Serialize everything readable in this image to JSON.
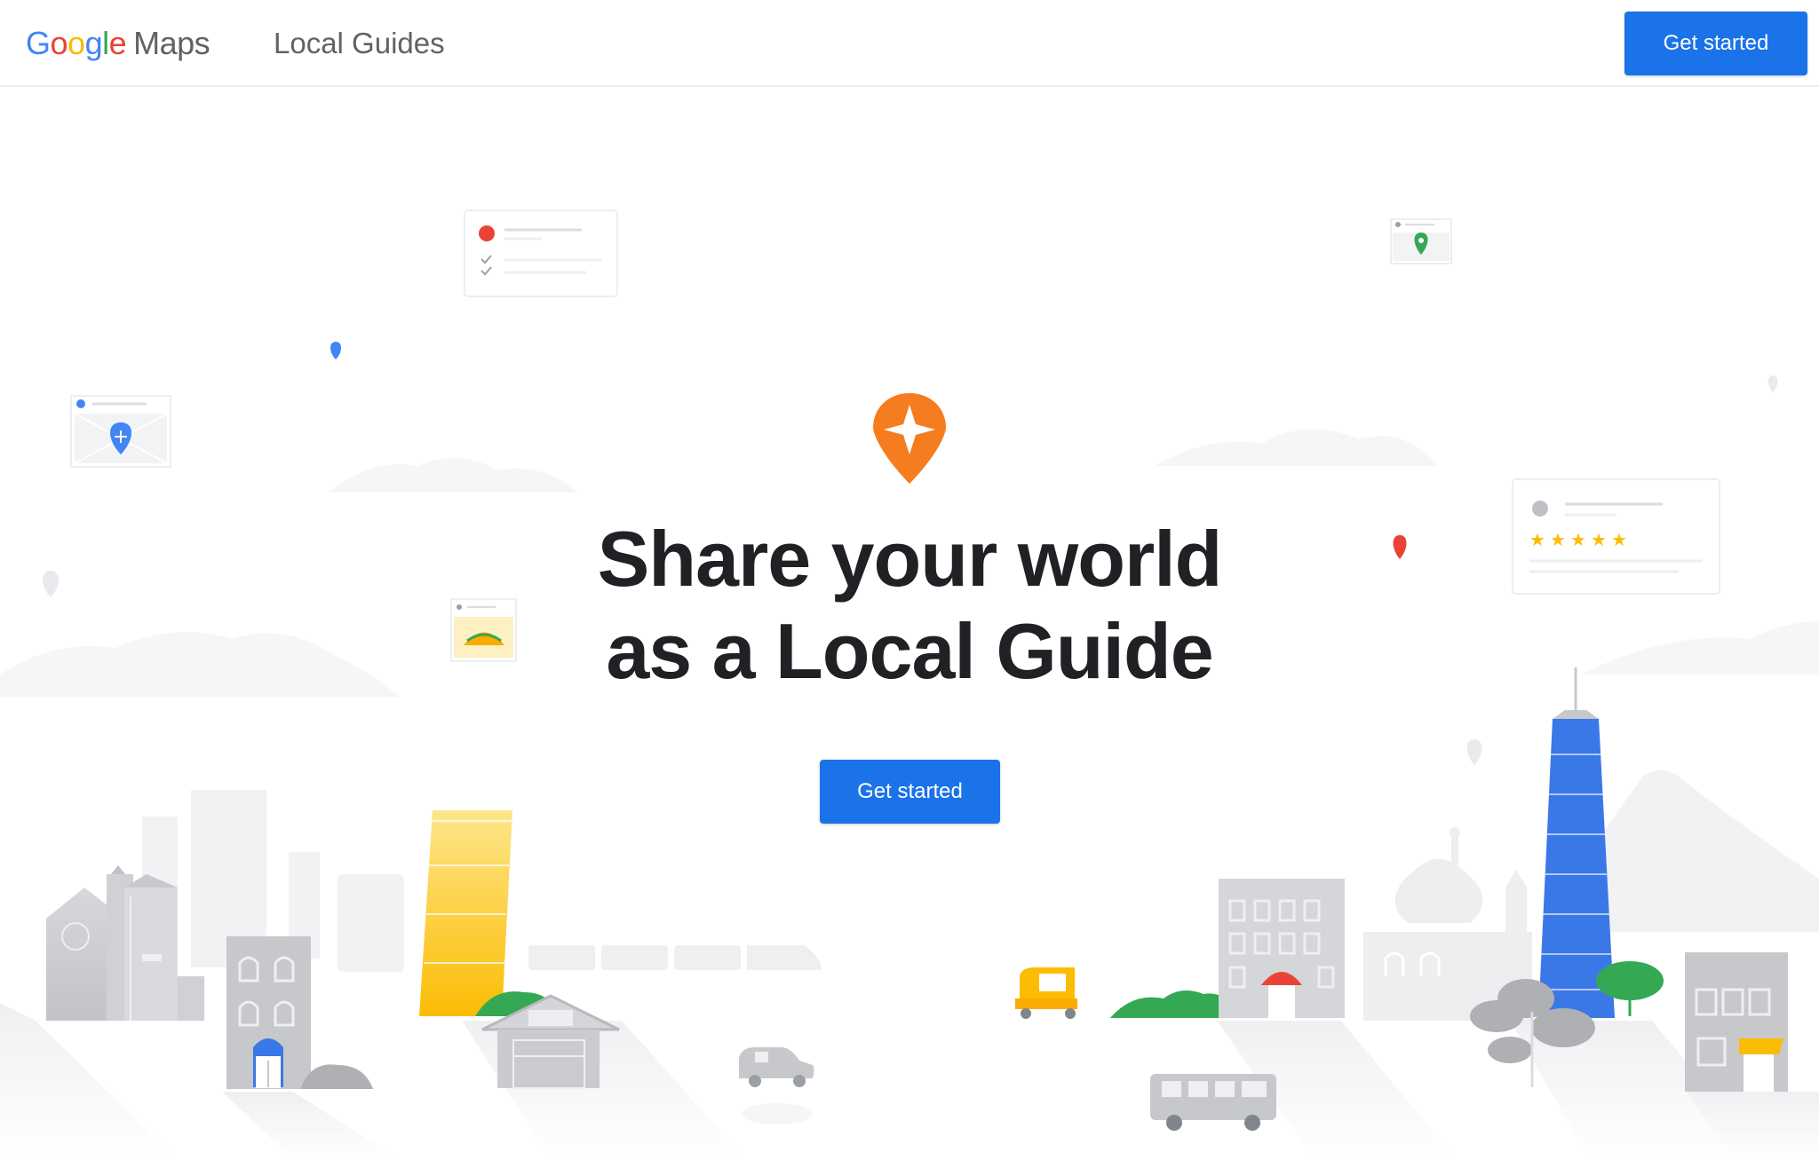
{
  "header": {
    "logo": {
      "google_letters": [
        {
          "char": "G",
          "color": "#4285f4"
        },
        {
          "char": "o",
          "color": "#ea4335"
        },
        {
          "char": "o",
          "color": "#fbbc05"
        },
        {
          "char": "g",
          "color": "#4285f4"
        },
        {
          "char": "l",
          "color": "#34a853"
        },
        {
          "char": "e",
          "color": "#ea4335"
        }
      ],
      "product": "Maps"
    },
    "nav_link": "Local Guides",
    "cta_label": "Get started"
  },
  "hero": {
    "badge_icon": "local-guides-star-pin-icon",
    "title_line1": "Share your world",
    "title_line2": "as a Local Guide",
    "cta_label": "Get started"
  },
  "colors": {
    "primary_blue": "#1a73e8",
    "badge_orange": "#f57c1f",
    "tower_blue": "#3b78e7",
    "building_yellow": "#fbbc04",
    "tree_green": "#34a853",
    "pin_red": "#ea4335"
  }
}
